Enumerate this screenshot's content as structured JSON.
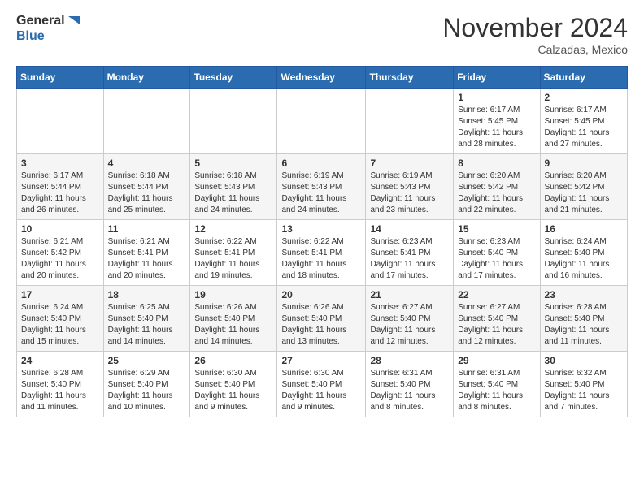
{
  "header": {
    "logo_line1": "General",
    "logo_line2": "Blue",
    "month": "November 2024",
    "location": "Calzadas, Mexico"
  },
  "weekdays": [
    "Sunday",
    "Monday",
    "Tuesday",
    "Wednesday",
    "Thursday",
    "Friday",
    "Saturday"
  ],
  "weeks": [
    [
      {
        "day": "",
        "sunrise": "",
        "sunset": "",
        "daylight": ""
      },
      {
        "day": "",
        "sunrise": "",
        "sunset": "",
        "daylight": ""
      },
      {
        "day": "",
        "sunrise": "",
        "sunset": "",
        "daylight": ""
      },
      {
        "day": "",
        "sunrise": "",
        "sunset": "",
        "daylight": ""
      },
      {
        "day": "",
        "sunrise": "",
        "sunset": "",
        "daylight": ""
      },
      {
        "day": "1",
        "sunrise": "Sunrise: 6:17 AM",
        "sunset": "Sunset: 5:45 PM",
        "daylight": "Daylight: 11 hours and 28 minutes."
      },
      {
        "day": "2",
        "sunrise": "Sunrise: 6:17 AM",
        "sunset": "Sunset: 5:45 PM",
        "daylight": "Daylight: 11 hours and 27 minutes."
      }
    ],
    [
      {
        "day": "3",
        "sunrise": "Sunrise: 6:17 AM",
        "sunset": "Sunset: 5:44 PM",
        "daylight": "Daylight: 11 hours and 26 minutes."
      },
      {
        "day": "4",
        "sunrise": "Sunrise: 6:18 AM",
        "sunset": "Sunset: 5:44 PM",
        "daylight": "Daylight: 11 hours and 25 minutes."
      },
      {
        "day": "5",
        "sunrise": "Sunrise: 6:18 AM",
        "sunset": "Sunset: 5:43 PM",
        "daylight": "Daylight: 11 hours and 24 minutes."
      },
      {
        "day": "6",
        "sunrise": "Sunrise: 6:19 AM",
        "sunset": "Sunset: 5:43 PM",
        "daylight": "Daylight: 11 hours and 24 minutes."
      },
      {
        "day": "7",
        "sunrise": "Sunrise: 6:19 AM",
        "sunset": "Sunset: 5:43 PM",
        "daylight": "Daylight: 11 hours and 23 minutes."
      },
      {
        "day": "8",
        "sunrise": "Sunrise: 6:20 AM",
        "sunset": "Sunset: 5:42 PM",
        "daylight": "Daylight: 11 hours and 22 minutes."
      },
      {
        "day": "9",
        "sunrise": "Sunrise: 6:20 AM",
        "sunset": "Sunset: 5:42 PM",
        "daylight": "Daylight: 11 hours and 21 minutes."
      }
    ],
    [
      {
        "day": "10",
        "sunrise": "Sunrise: 6:21 AM",
        "sunset": "Sunset: 5:42 PM",
        "daylight": "Daylight: 11 hours and 20 minutes."
      },
      {
        "day": "11",
        "sunrise": "Sunrise: 6:21 AM",
        "sunset": "Sunset: 5:41 PM",
        "daylight": "Daylight: 11 hours and 20 minutes."
      },
      {
        "day": "12",
        "sunrise": "Sunrise: 6:22 AM",
        "sunset": "Sunset: 5:41 PM",
        "daylight": "Daylight: 11 hours and 19 minutes."
      },
      {
        "day": "13",
        "sunrise": "Sunrise: 6:22 AM",
        "sunset": "Sunset: 5:41 PM",
        "daylight": "Daylight: 11 hours and 18 minutes."
      },
      {
        "day": "14",
        "sunrise": "Sunrise: 6:23 AM",
        "sunset": "Sunset: 5:41 PM",
        "daylight": "Daylight: 11 hours and 17 minutes."
      },
      {
        "day": "15",
        "sunrise": "Sunrise: 6:23 AM",
        "sunset": "Sunset: 5:40 PM",
        "daylight": "Daylight: 11 hours and 17 minutes."
      },
      {
        "day": "16",
        "sunrise": "Sunrise: 6:24 AM",
        "sunset": "Sunset: 5:40 PM",
        "daylight": "Daylight: 11 hours and 16 minutes."
      }
    ],
    [
      {
        "day": "17",
        "sunrise": "Sunrise: 6:24 AM",
        "sunset": "Sunset: 5:40 PM",
        "daylight": "Daylight: 11 hours and 15 minutes."
      },
      {
        "day": "18",
        "sunrise": "Sunrise: 6:25 AM",
        "sunset": "Sunset: 5:40 PM",
        "daylight": "Daylight: 11 hours and 14 minutes."
      },
      {
        "day": "19",
        "sunrise": "Sunrise: 6:26 AM",
        "sunset": "Sunset: 5:40 PM",
        "daylight": "Daylight: 11 hours and 14 minutes."
      },
      {
        "day": "20",
        "sunrise": "Sunrise: 6:26 AM",
        "sunset": "Sunset: 5:40 PM",
        "daylight": "Daylight: 11 hours and 13 minutes."
      },
      {
        "day": "21",
        "sunrise": "Sunrise: 6:27 AM",
        "sunset": "Sunset: 5:40 PM",
        "daylight": "Daylight: 11 hours and 12 minutes."
      },
      {
        "day": "22",
        "sunrise": "Sunrise: 6:27 AM",
        "sunset": "Sunset: 5:40 PM",
        "daylight": "Daylight: 11 hours and 12 minutes."
      },
      {
        "day": "23",
        "sunrise": "Sunrise: 6:28 AM",
        "sunset": "Sunset: 5:40 PM",
        "daylight": "Daylight: 11 hours and 11 minutes."
      }
    ],
    [
      {
        "day": "24",
        "sunrise": "Sunrise: 6:28 AM",
        "sunset": "Sunset: 5:40 PM",
        "daylight": "Daylight: 11 hours and 11 minutes."
      },
      {
        "day": "25",
        "sunrise": "Sunrise: 6:29 AM",
        "sunset": "Sunset: 5:40 PM",
        "daylight": "Daylight: 11 hours and 10 minutes."
      },
      {
        "day": "26",
        "sunrise": "Sunrise: 6:30 AM",
        "sunset": "Sunset: 5:40 PM",
        "daylight": "Daylight: 11 hours and 9 minutes."
      },
      {
        "day": "27",
        "sunrise": "Sunrise: 6:30 AM",
        "sunset": "Sunset: 5:40 PM",
        "daylight": "Daylight: 11 hours and 9 minutes."
      },
      {
        "day": "28",
        "sunrise": "Sunrise: 6:31 AM",
        "sunset": "Sunset: 5:40 PM",
        "daylight": "Daylight: 11 hours and 8 minutes."
      },
      {
        "day": "29",
        "sunrise": "Sunrise: 6:31 AM",
        "sunset": "Sunset: 5:40 PM",
        "daylight": "Daylight: 11 hours and 8 minutes."
      },
      {
        "day": "30",
        "sunrise": "Sunrise: 6:32 AM",
        "sunset": "Sunset: 5:40 PM",
        "daylight": "Daylight: 11 hours and 7 minutes."
      }
    ]
  ]
}
